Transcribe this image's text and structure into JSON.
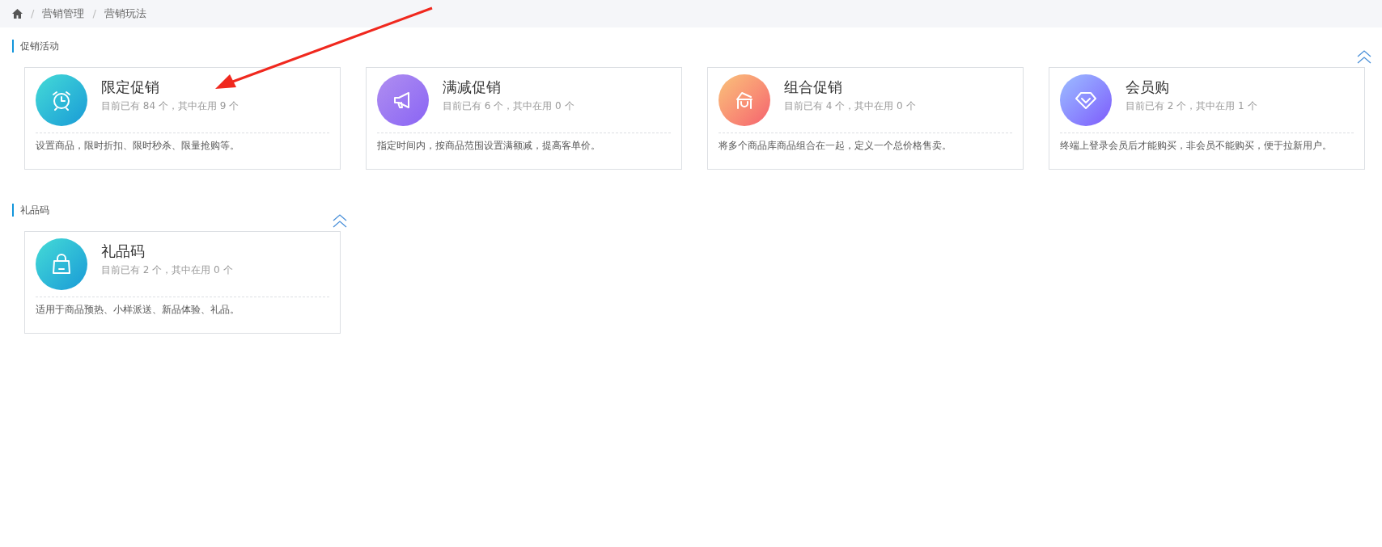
{
  "breadcrumb": [
    {
      "kind": "home",
      "separator": "/"
    },
    {
      "kind": "link",
      "label": "营销管理",
      "separator": "/"
    },
    {
      "kind": "current",
      "label": "营销玩法"
    }
  ],
  "sections": [
    {
      "title": "促销活动",
      "expanded": true,
      "cards": [
        {
          "kind": "clock",
          "title": "限定促销",
          "stats": "目前已有 84 个，其中在用 9 个",
          "description": "设置商品，限时折扣、限时秒杀、限量抢购等。"
        },
        {
          "kind": "megaphone",
          "title": "满减促销",
          "stats": "目前已有 6 个，其中在用 0 个",
          "description": "指定时间内，按商品范围设置满额减，提高客单价。"
        },
        {
          "kind": "basket",
          "title": "组合促销",
          "stats": "目前已有 4 个，其中在用 0 个",
          "description": "将多个商品库商品组合在一起，定义一个总价格售卖。"
        },
        {
          "kind": "diamond",
          "title": "会员购",
          "stats": "目前已有 2 个，其中在用 1 个",
          "description": "终端上登录会员后才能购买，非会员不能购买，便于拉新用户。"
        }
      ]
    },
    {
      "title": "礼品码",
      "expanded": true,
      "cards": [
        {
          "kind": "bag",
          "title": "礼品码",
          "stats": "目前已有 2 个，其中在用 0 个",
          "description": "适用于商品预热、小样派送、新品体验、礼品。"
        }
      ]
    }
  ],
  "annotation": {
    "kind": "arrow"
  }
}
